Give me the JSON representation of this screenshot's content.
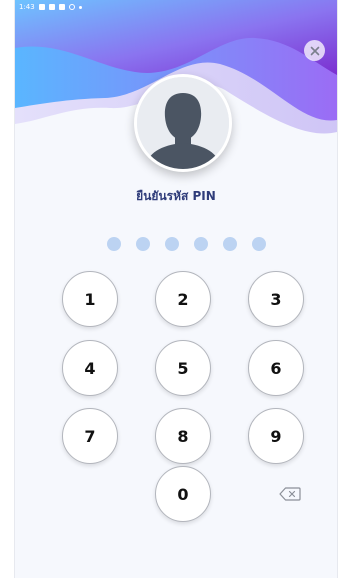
{
  "status_bar": {
    "time": "1:43"
  },
  "pin_screen": {
    "title": "ยืนยันรหัส PIN",
    "pin_length": 6,
    "entered_digits": 0
  },
  "keypad": {
    "keys": [
      "1",
      "2",
      "3",
      "4",
      "5",
      "6",
      "7",
      "8",
      "9",
      "0"
    ]
  },
  "icons": {
    "close": "close-icon",
    "avatar": "user-avatar-placeholder",
    "delete": "backspace-icon"
  },
  "colors": {
    "wave_primary": "#7a3fd1",
    "wave_secondary": "#5aa2f0",
    "title": "#2f3c7a",
    "pin_dot": "#bcd3f2",
    "background": "#f6f8fd"
  }
}
